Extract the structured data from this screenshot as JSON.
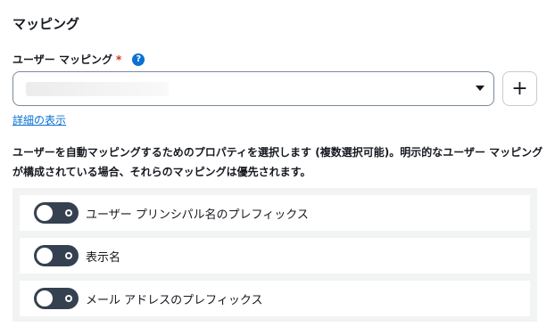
{
  "section": {
    "title": "マッピング"
  },
  "field": {
    "label": "ユーザー マッピング",
    "required_mark": "*",
    "info_icon": "info-icon",
    "info_glyph": "?"
  },
  "select": {
    "icon": "caret-down-icon"
  },
  "add_button": {
    "label": "+",
    "icon": "plus-icon"
  },
  "details_link": "詳細の表示",
  "description": "ユーザーを自動マッピングするためのプロパティを選択します (複数選択可能)。明示的なユーザー マッピングが構成されている場合、それらのマッピングは優先されます。",
  "options": [
    {
      "label": "ユーザー プリンシパル名のプレフィックス",
      "enabled": false
    },
    {
      "label": "表示名",
      "enabled": false
    },
    {
      "label": "メール アドレスのプレフィックス",
      "enabled": false
    }
  ],
  "colors": {
    "accent": "#0972d3",
    "required": "#d13212",
    "toggle_off": "#354150",
    "panel": "#f2f3f3"
  }
}
